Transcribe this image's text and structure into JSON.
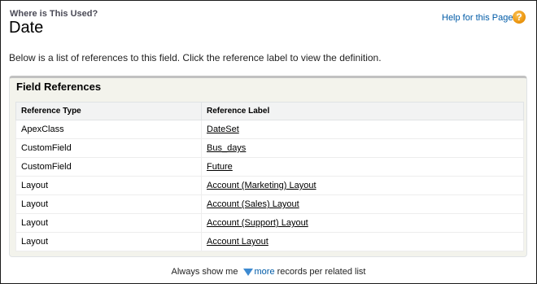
{
  "header": {
    "subtitle": "Where is This Used?",
    "title": "Date",
    "help_link": "Help for this Page",
    "help_icon": "?"
  },
  "intro": "Below is a list of references to this field. Click the reference label to view the definition.",
  "panel": {
    "title": "Field References",
    "columns": [
      "Reference Type",
      "Reference Label"
    ],
    "rows": [
      {
        "type": "ApexClass",
        "label": "DateSet"
      },
      {
        "type": "CustomField",
        "label": "Bus_days"
      },
      {
        "type": "CustomField",
        "label": "Future"
      },
      {
        "type": "Layout",
        "label": "Account (Marketing) Layout"
      },
      {
        "type": "Layout",
        "label": "Account (Sales) Layout"
      },
      {
        "type": "Layout",
        "label": "Account (Support) Layout"
      },
      {
        "type": "Layout",
        "label": "Account Layout"
      }
    ]
  },
  "footer": {
    "prefix": "Always show me",
    "more_link": "more",
    "suffix": "records per related list"
  },
  "colors": {
    "link": "#015ba7",
    "help_icon": "#ee9b16",
    "panel_bg": "#f3f3ec"
  }
}
